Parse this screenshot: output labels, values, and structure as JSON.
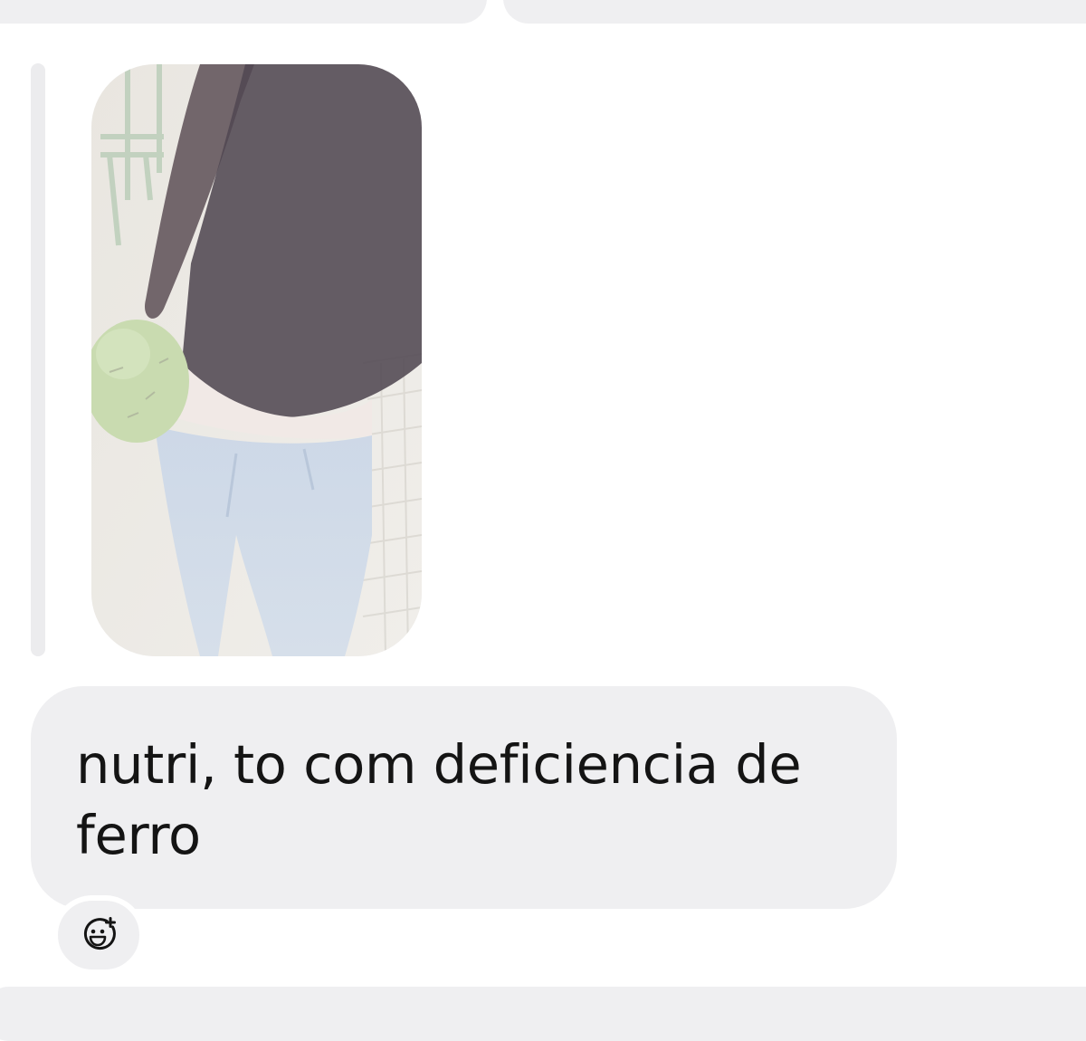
{
  "thread": {
    "shared_photo": {
      "type": "image",
      "description_icon": "photo-attachment"
    },
    "message": {
      "text": "nutri, to com deficiencia de ferro"
    },
    "reaction": {
      "icon": "add-reaction-icon"
    }
  },
  "colors": {
    "bubble": "#efeff1",
    "text": "#141414",
    "background": "#ffffff"
  }
}
